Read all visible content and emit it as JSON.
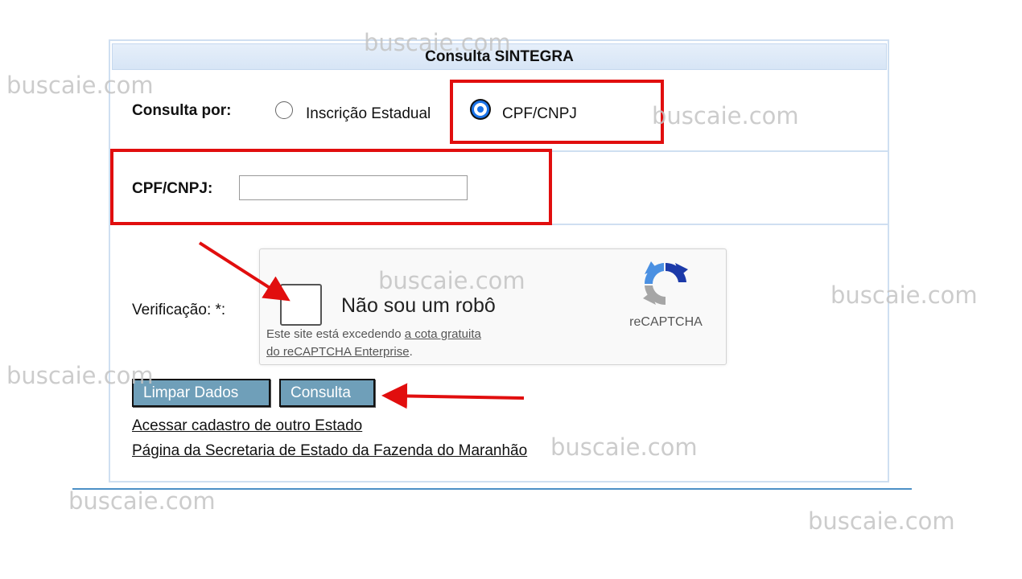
{
  "header": {
    "title": "Consulta SINTEGRA"
  },
  "consulta_por": {
    "label": "Consulta por:",
    "options": [
      {
        "label": "Inscrição Estadual",
        "checked": false
      },
      {
        "label": "CPF/CNPJ",
        "checked": true
      }
    ]
  },
  "cpf_field": {
    "label": "CPF/CNPJ:",
    "value": ""
  },
  "verificacao": {
    "label": "Verificação: *:"
  },
  "recaptcha": {
    "checkbox_label": "Não sou um robô",
    "note_prefix": "Este site está excedendo ",
    "note_link1": "a cota gratuita",
    "note_link2": "do reCAPTCHA Enterprise",
    "note_suffix": ".",
    "brand": "reCAPTCHA"
  },
  "buttons": {
    "clear": "Limpar Dados",
    "submit": "Consulta"
  },
  "links": [
    "Acessar cadastro de outro Estado",
    "Página da Secretaria de Estado da Fazenda do Maranhão"
  ],
  "watermark": "buscaie.com",
  "colors": {
    "annotation_red": "#e10e0e",
    "button_blue": "#6f9fb9",
    "radio_blue": "#1a73e8"
  }
}
